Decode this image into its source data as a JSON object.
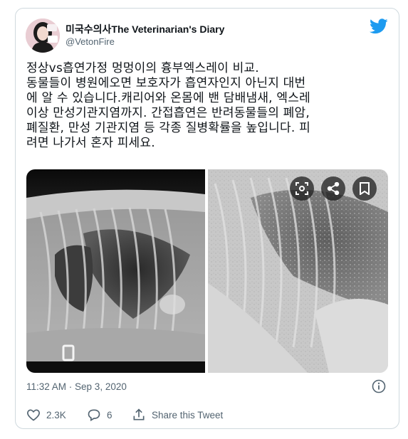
{
  "user": {
    "display_name": "미국수의사The Veterinarian's Diary",
    "handle": "@VetonFire",
    "avatar_icon": "avatar"
  },
  "tweet": {
    "text_lines": [
      "정상vs흡연가정 멍멍이의 흉부엑스레이 비교.",
      "동물들이 병원에오면 보호자가 흡연자인지 아닌지 대번",
      "에 알 수 있습니다.캐리어와 온몸에 밴 담배냄새, 엑스레",
      "이상 만성기관지염까지. 간접흡연은 반려동물들의 폐암,",
      "폐질환, 만성 기관지염 등 각종 질병확률을 높입니다. 피",
      "려면 나가서 혼자 피세요."
    ],
    "timestamp": "11:32 AM · Sep 3, 2020"
  },
  "media": {
    "buttons": [
      "scan-icon",
      "share-icon",
      "bookmark-icon"
    ]
  },
  "actions": {
    "likes": "2.3K",
    "replies": "6",
    "share_label": "Share this Tweet"
  },
  "colors": {
    "brand_blue": "#1d9bf0",
    "secondary_text": "#536471",
    "border": "#cfd9de"
  }
}
